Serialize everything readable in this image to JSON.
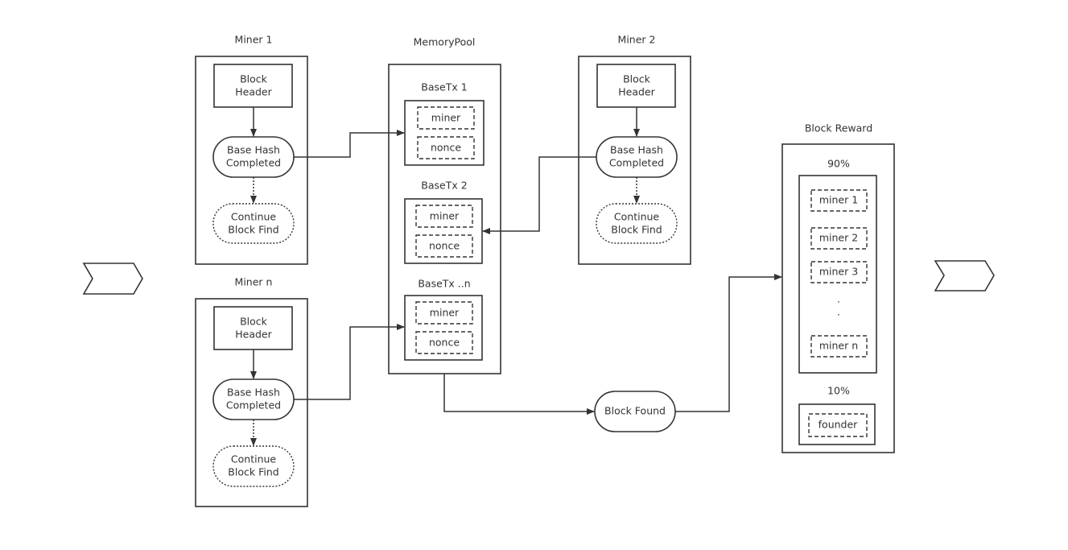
{
  "miners": [
    {
      "title": "Miner  1",
      "header": [
        "Block",
        "Header"
      ],
      "hash": [
        "Base Hash",
        "Completed"
      ],
      "continue": [
        "Continue",
        "Block Find"
      ]
    },
    {
      "title": "Miner  2",
      "header": [
        "Block",
        "Header"
      ],
      "hash": [
        "Base Hash",
        "Completed"
      ],
      "continue": [
        "Continue",
        "Block Find"
      ]
    },
    {
      "title": "Miner  n",
      "header": [
        "Block",
        "Header"
      ],
      "hash": [
        "Base Hash",
        "Completed"
      ],
      "continue": [
        "Continue",
        "Block Find"
      ]
    }
  ],
  "memory_pool": {
    "title": "MemoryPool",
    "txs": [
      {
        "title": "BaseTx  1",
        "fields": [
          "miner",
          "nonce"
        ]
      },
      {
        "title": "BaseTx  2",
        "fields": [
          "miner",
          "nonce"
        ]
      },
      {
        "title": "BaseTx ..n",
        "fields": [
          "miner",
          "nonce"
        ]
      }
    ]
  },
  "block_found": "Block Found",
  "block_reward": {
    "title": "Block Reward",
    "miners_share": "90%",
    "miners": [
      "miner 1",
      "miner 2",
      "miner 3",
      "miner n"
    ],
    "ellipsis": ".",
    "founder_share": "10%",
    "founder": "founder"
  },
  "colors": {
    "stroke": "#333333",
    "background": "#ffffff"
  }
}
